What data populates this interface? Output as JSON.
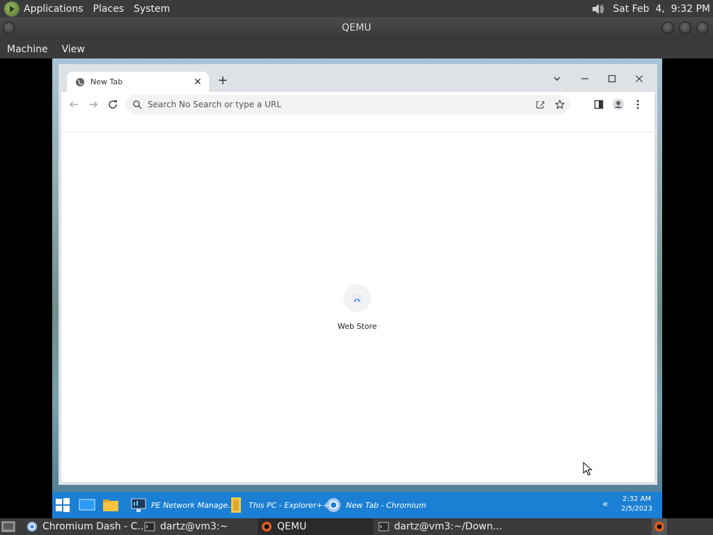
{
  "top_panel": {
    "menus": [
      "Applications",
      "Places",
      "System"
    ],
    "datetime": "Sat Feb  4,  9:32 PM",
    "icons": [
      "gnome-foot-icon",
      "volume-icon"
    ]
  },
  "qemu": {
    "title": "QEMU",
    "menus": [
      "Machine",
      "View"
    ]
  },
  "browser": {
    "tab_title": "New Tab",
    "omnibox_placeholder": "Search No Search or type a URL",
    "shortcuts": [
      {
        "label": "Web Store",
        "icon": "webstore-icon"
      }
    ]
  },
  "windows_taskbar": {
    "items": [
      {
        "label": "PE Network Manage...",
        "icon": "network-manager-icon"
      },
      {
        "label": "This PC - Explorer++",
        "icon": "explorer-icon"
      },
      {
        "label": "New Tab - Chromium",
        "icon": "chromium-icon"
      }
    ],
    "time": "2:32 AM",
    "date": "2/5/2023"
  },
  "bottom_panel": {
    "items": [
      {
        "label": "Chromium Dash - C...",
        "icon": "chromium-icon"
      },
      {
        "label": "dartz@vm3:~",
        "icon": "terminal-icon"
      },
      {
        "label": "QEMU",
        "icon": "qemu-icon",
        "active": true
      },
      {
        "label": "dartz@vm3:~/Down...",
        "icon": "terminal-icon"
      }
    ]
  },
  "colors": {
    "gnome_panel": "#3b3b3b",
    "windows_taskbar": "#1b7fd3",
    "browser_frame": "#dee1e6"
  }
}
